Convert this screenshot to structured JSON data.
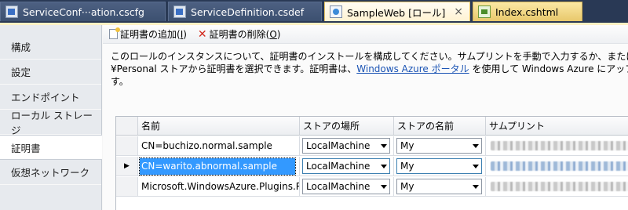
{
  "tabs": [
    {
      "label": "ServiceConf···ation.cscfg",
      "icon": "config-file-icon",
      "active": false
    },
    {
      "label": "ServiceDefinition.csdef",
      "icon": "config-file-icon",
      "active": false
    },
    {
      "label": "SampleWeb [ロール]",
      "icon": "web-role-icon",
      "active": true,
      "close": "×"
    },
    {
      "label": "Index.cshtml",
      "icon": "cshtml-file-icon",
      "active": false
    }
  ],
  "sidebar": {
    "items": [
      {
        "label": "構成"
      },
      {
        "label": "設定"
      },
      {
        "label": "エンドポイント"
      },
      {
        "label": "ローカル ストレージ"
      },
      {
        "label": "証明書",
        "selected": true
      },
      {
        "label": "仮想ネットワーク"
      }
    ]
  },
  "toolbar": {
    "add_label": "証明書の追加(",
    "add_key": "I",
    "add_close": ")",
    "delete_label": "証明書の削除(",
    "delete_key": "O",
    "delete_close": ")"
  },
  "description": {
    "line1": "このロールのインスタンスについて、証明書のインストールを構成してください。サムプリントを手動で入力するか、または Lo",
    "line2_before": "¥Personal ストアから証明書を選択できます。証明書は、",
    "link": "Windows Azure ポータル",
    "line2_after": " を使用して Windows Azure にアップロー",
    "line3": "す。"
  },
  "grid": {
    "headers": [
      "名前",
      "ストアの場所",
      "ストアの名前",
      "サムプリント"
    ],
    "rows": [
      {
        "name": "CN=buchizo.normal.sample",
        "location": "LocalMachine",
        "store": "My",
        "selected": false
      },
      {
        "name": "CN=warito.abnormal.sample",
        "location": "LocalMachine",
        "store": "My",
        "selected": true
      },
      {
        "name": "Microsoft.WindowsAzure.Plugins.R···",
        "location": "LocalMachine",
        "store": "My",
        "selected": false
      }
    ],
    "current_row_marker": "▶"
  },
  "colors": {
    "accent": "#3399ff",
    "link": "#1a53b4",
    "tab_background": "#293955"
  }
}
